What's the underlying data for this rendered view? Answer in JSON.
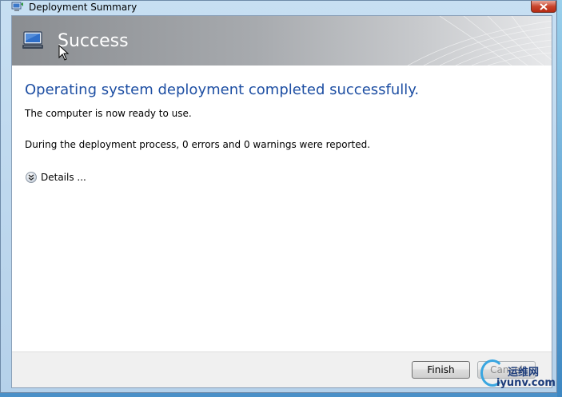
{
  "window": {
    "title": "Deployment Summary",
    "close_label": "✕"
  },
  "banner": {
    "title": "Success"
  },
  "content": {
    "heading": "Operating system deployment completed successfully.",
    "ready_text": "The computer is now ready to use.",
    "report_text": "During the deployment process, 0 errors and 0 warnings were reported.",
    "details_label": "Details ..."
  },
  "buttons": {
    "finish": "Finish",
    "cancel": "Cancel"
  },
  "watermark": {
    "brand": "运维网",
    "url": "iyunv.com"
  },
  "colors": {
    "heading": "#1e4fa3",
    "close_button": "#c9452c"
  }
}
